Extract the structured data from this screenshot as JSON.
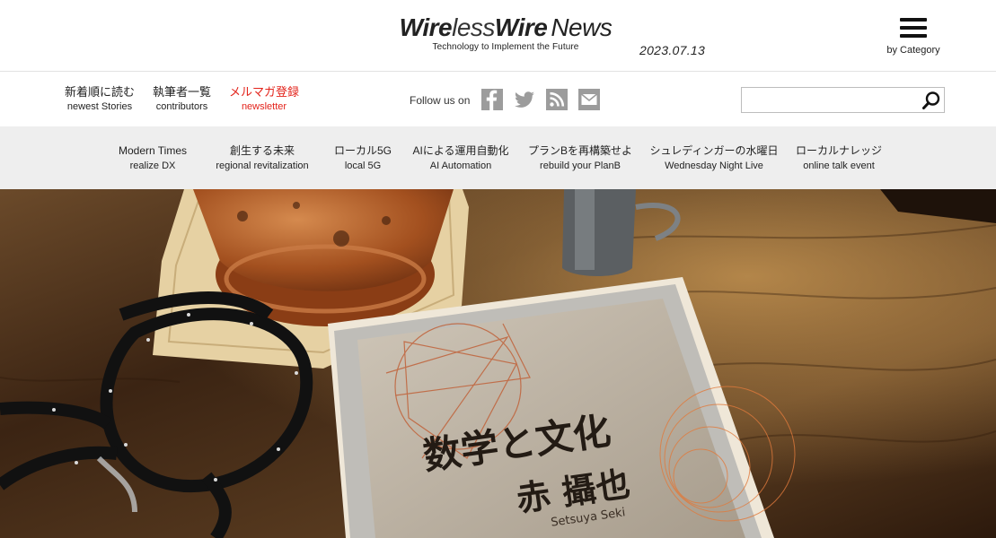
{
  "header": {
    "logo": {
      "part1": "Wire",
      "part2": "less",
      "part3": "Wire",
      "part4": "News"
    },
    "tagline": "Technology to Implement the Future",
    "date": "2023.07.13",
    "menu_label": "by Category"
  },
  "subnav": {
    "links": [
      {
        "jp": "新着順に読む",
        "en": "newest Stories"
      },
      {
        "jp": "執筆者一覧",
        "en": "contributors"
      },
      {
        "jp": "メルマガ登録",
        "en": "newsletter"
      }
    ],
    "follow_label": "Follow us on",
    "social": [
      "facebook-icon",
      "twitter-icon",
      "rss-icon",
      "mail-icon"
    ],
    "search": {
      "value": "",
      "placeholder": ""
    }
  },
  "categories": [
    {
      "jp": "Modern Times",
      "en": "realize DX"
    },
    {
      "jp": "創生する未来",
      "en": "regional revitalization"
    },
    {
      "jp": "ローカル5G",
      "en": "local 5G"
    },
    {
      "jp": "AIによる運用自動化",
      "en": "AI Automation"
    },
    {
      "jp": "プランBを再構築せよ",
      "en": "rebuild your PlanB"
    },
    {
      "jp": "シュレディンガーの水曜日",
      "en": "Wednesday Night Live"
    },
    {
      "jp": "ローカルナレッジ",
      "en": "online talk event"
    }
  ],
  "hero": {
    "book_title": "数学と文化",
    "book_author": "赤 攝也",
    "book_author_roman": "Setsuya Seki"
  },
  "colors": {
    "accent_red": "#e3231b",
    "category_bg": "#eeeeee",
    "social_gray": "#9c9c9c"
  }
}
